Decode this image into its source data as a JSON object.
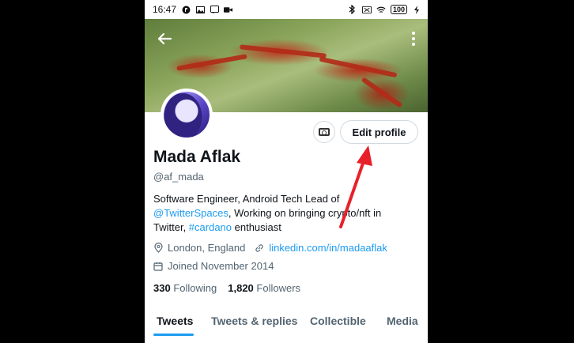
{
  "status_bar": {
    "time": "16:47",
    "battery": "100"
  },
  "profile": {
    "name": "Mada Aflak",
    "handle": "@af_mada",
    "bio_part1": "Software Engineer, Android Tech Lead of ",
    "bio_mention": "@TwitterSpaces",
    "bio_part2": ", Working on bringing crypto/nft in Twitter, ",
    "bio_hashtag": "#cardano",
    "bio_part3": " enthusiast",
    "location": "London, England",
    "website": "linkedin.com/in/madaaflak",
    "joined": "Joined November 2014",
    "following_count": "330",
    "following_label": "Following",
    "followers_count": "1,820",
    "followers_label": "Followers"
  },
  "buttons": {
    "edit_profile": "Edit profile",
    "back_icon": "arrow-left-icon",
    "more_icon": "kebab-menu-icon",
    "camera_icon": "camera-icon"
  },
  "tabs": [
    {
      "label": "Tweets",
      "active": true
    },
    {
      "label": "Tweets & replies",
      "active": false
    },
    {
      "label": "Collectible",
      "active": false
    },
    {
      "label": "Media",
      "active": false
    }
  ],
  "colors": {
    "accent": "#1d9bf0",
    "annotation_arrow": "#e8202a",
    "text_primary": "#0f1419",
    "text_secondary": "#536471"
  }
}
